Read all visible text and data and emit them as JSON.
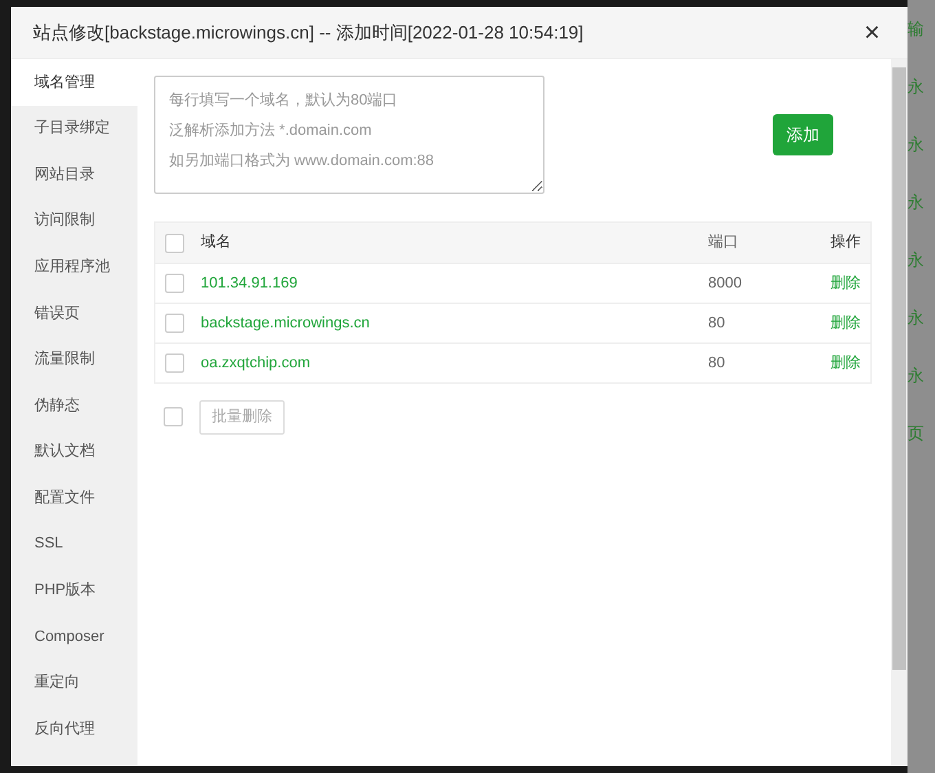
{
  "dialog": {
    "title": "站点修改[backstage.microwings.cn] -- 添加时间[2022-01-28 10:54:19]",
    "close": "×"
  },
  "sidebar": {
    "items": [
      {
        "label": "域名管理",
        "selected": true
      },
      {
        "label": "子目录绑定",
        "selected": false
      },
      {
        "label": "网站目录",
        "selected": false
      },
      {
        "label": "访问限制",
        "selected": false
      },
      {
        "label": "应用程序池",
        "selected": false
      },
      {
        "label": "错误页",
        "selected": false
      },
      {
        "label": "流量限制",
        "selected": false
      },
      {
        "label": "伪静态",
        "selected": false
      },
      {
        "label": "默认文档",
        "selected": false
      },
      {
        "label": "配置文件",
        "selected": false
      },
      {
        "label": "SSL",
        "selected": false
      },
      {
        "label": "PHP版本",
        "selected": false
      },
      {
        "label": "Composer",
        "selected": false
      },
      {
        "label": "重定向",
        "selected": false
      },
      {
        "label": "反向代理",
        "selected": false
      }
    ]
  },
  "domain_input": {
    "placeholder_lines": [
      "每行填写一个域名，默认为80端口",
      "泛解析添加方法 *.domain.com",
      "如另加端口格式为 www.domain.com:88"
    ]
  },
  "add_button": "添加",
  "table": {
    "columns": [
      "域名",
      "端口",
      "操作"
    ],
    "header_checked": false,
    "rows": [
      {
        "domain": "101.34.91.169",
        "port": "8000",
        "action": "删除",
        "checked": false
      },
      {
        "domain": "backstage.microwings.cn",
        "port": "80",
        "action": "删除",
        "checked": false
      },
      {
        "domain": "oa.zxqtchip.com",
        "port": "80",
        "action": "删除",
        "checked": false
      }
    ]
  },
  "batch": {
    "checked": false,
    "button": "批量删除",
    "disabled": true
  },
  "backdrop": {
    "texts": [
      "输",
      "永",
      "永",
      "永",
      "永",
      "永",
      "永",
      "页"
    ]
  }
}
